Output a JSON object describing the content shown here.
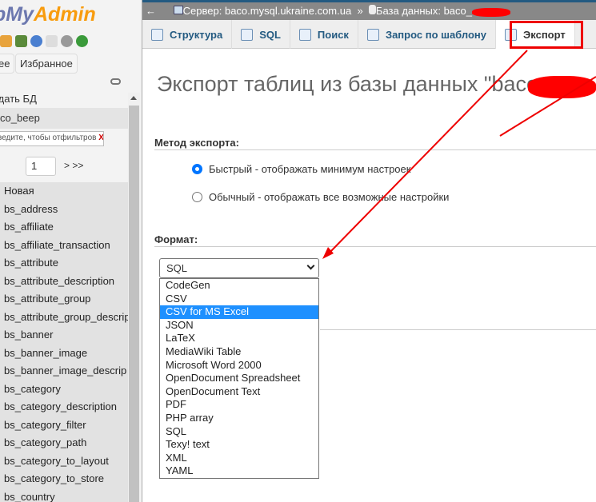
{
  "sidebar": {
    "logo_a": "pMy",
    "logo_b": "Admin",
    "logo_prefix": "p",
    "recent_label": "ее",
    "favorites_label": "Избранное",
    "new_db": "здать БД",
    "db_name": "co_beep",
    "filter_placeholder": "ведите, чтобы отфильтров",
    "filter_clear": "X",
    "page": "1",
    "next": "> >>",
    "tables": [
      "Новая",
      "bs_address",
      "bs_affiliate",
      "bs_affiliate_transaction",
      "bs_attribute",
      "bs_attribute_description",
      "bs_attribute_group",
      "bs_attribute_group_descrip",
      "bs_banner",
      "bs_banner_image",
      "bs_banner_image_descrip",
      "bs_category",
      "bs_category_description",
      "bs_category_filter",
      "bs_category_path",
      "bs_category_to_layout",
      "bs_category_to_store",
      "bs_country"
    ]
  },
  "breadcrumb": {
    "back": "←",
    "server": "Сервер: baco.mysql.ukraine.com.ua",
    "sep": "»",
    "database": "База данных: baco_"
  },
  "tabs": [
    {
      "label": "Структура",
      "icon": "structure-icon"
    },
    {
      "label": "SQL",
      "icon": "sql-icon"
    },
    {
      "label": "Поиск",
      "icon": "search-icon"
    },
    {
      "label": "Запрос по шаблону",
      "icon": "query-icon"
    },
    {
      "label": "Экспорт",
      "icon": "export-icon",
      "active": true
    }
  ],
  "main": {
    "title": "Экспорт таблиц из базы данных \"baco_",
    "method_label": "Метод экспорта:",
    "method_quick": "Быстрый - отображать минимум настроек",
    "method_custom": "Обычный - отображать все возможные настройки",
    "method_selected": "quick",
    "format_label": "Формат:",
    "format_value": "SQL",
    "format_options": [
      "CodeGen",
      "CSV",
      "CSV for MS Excel",
      "JSON",
      "LaTeX",
      "MediaWiki Table",
      "Microsoft Word 2000",
      "OpenDocument Spreadsheet",
      "OpenDocument Text",
      "PDF",
      "PHP array",
      "SQL",
      "Texy! text",
      "XML",
      "YAML"
    ],
    "highlighted_option": "CSV for MS Excel"
  },
  "colors": {
    "annotation": "#ee0000",
    "highlight": "#1e90ff",
    "link": "#235a81"
  }
}
